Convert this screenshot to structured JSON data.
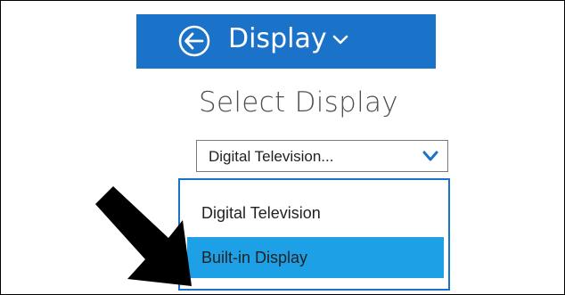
{
  "header": {
    "title": "Display",
    "accent_color": "#1a73c9",
    "back_icon": "back-arrow-circle-icon",
    "title_chevron_icon": "chevron-down-icon"
  },
  "page_title": "Select Display",
  "display_select": {
    "selected_value": "Digital Television...",
    "chevron_icon": "chevron-down-icon",
    "options": [
      {
        "label": "Digital Television",
        "highlighted": false
      },
      {
        "label": "Built-in Display",
        "highlighted": true
      }
    ],
    "highlight_color": "#1ea0e6"
  },
  "callout_arrow_icon": "pointer-arrow-icon"
}
